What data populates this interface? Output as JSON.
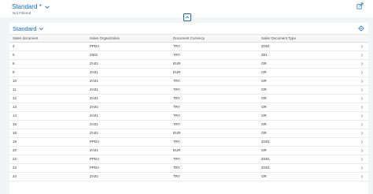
{
  "header": {
    "variant_title": "Standard *",
    "filter_status": "Not Filtered"
  },
  "table": {
    "title": "Standard",
    "columns": [
      "Sales document",
      "Sales Organization",
      "Document Currency",
      "Sales Document Type"
    ],
    "rows": [
      {
        "doc": "2",
        "org": "PPDA",
        "cur": "TRY",
        "type": "ZS01"
      },
      {
        "doc": "5",
        "org": "Z001",
        "cur": "TRY",
        "type": "Z01"
      },
      {
        "doc": "6",
        "org": "ZA01",
        "cur": "EUR",
        "type": "OR"
      },
      {
        "doc": "9",
        "org": "ZA01",
        "cur": "EUR",
        "type": "OR"
      },
      {
        "doc": "10",
        "org": "ZA01",
        "cur": "TRY",
        "type": "OR"
      },
      {
        "doc": "11",
        "org": "ZA01",
        "cur": "TRY",
        "type": "OR"
      },
      {
        "doc": "12",
        "org": "ZA01",
        "cur": "TRY",
        "type": "OR"
      },
      {
        "doc": "13",
        "org": "ZA01",
        "cur": "TRY",
        "type": "OR"
      },
      {
        "doc": "14",
        "org": "ZA01",
        "cur": "TRY",
        "type": "OR"
      },
      {
        "doc": "15",
        "org": "ZA01",
        "cur": "TRY",
        "type": "OR"
      },
      {
        "doc": "18",
        "org": "ZA01",
        "cur": "EUR",
        "type": "OR"
      },
      {
        "doc": "19",
        "org": "PPDA",
        "cur": "TRY",
        "type": "ZS01"
      },
      {
        "doc": "20",
        "org": "ZA01",
        "cur": "EUR",
        "type": "OR"
      },
      {
        "doc": "22",
        "org": "PPDA",
        "cur": "TRY",
        "type": "ZS01"
      },
      {
        "doc": "23",
        "org": "PPDA",
        "cur": "TRY",
        "type": "ZS01"
      },
      {
        "doc": "24",
        "org": "ZA01",
        "cur": "TRY",
        "type": "OR"
      }
    ]
  },
  "icons": {
    "variant_chevron": "chevron-down-icon",
    "share": "share-icon",
    "collapse": "collapse-header-icon",
    "settings": "settings-gear-icon",
    "row_nav": "chevron-right-icon"
  },
  "colors": {
    "accent": "#0a6ed1",
    "background": "#f3f4f5",
    "text": "#32363a"
  }
}
